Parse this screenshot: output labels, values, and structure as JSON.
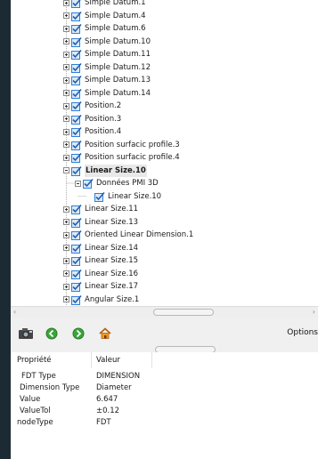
{
  "tree": {
    "rows": [
      {
        "label": "Simple Datum.1",
        "level": 0,
        "expander": "plus",
        "bold": false
      },
      {
        "label": "Simple Datum.4",
        "level": 0,
        "expander": "plus",
        "bold": false
      },
      {
        "label": "Simple Datum.6",
        "level": 0,
        "expander": "plus",
        "bold": false
      },
      {
        "label": "Simple Datum.10",
        "level": 0,
        "expander": "plus",
        "bold": false
      },
      {
        "label": "Simple Datum.11",
        "level": 0,
        "expander": "plus",
        "bold": false
      },
      {
        "label": "Simple Datum.12",
        "level": 0,
        "expander": "plus",
        "bold": false
      },
      {
        "label": "Simple Datum.13",
        "level": 0,
        "expander": "plus",
        "bold": false
      },
      {
        "label": "Simple Datum.14",
        "level": 0,
        "expander": "plus",
        "bold": false
      },
      {
        "label": "Position.2",
        "level": 0,
        "expander": "plus",
        "bold": false
      },
      {
        "label": "Position.3",
        "level": 0,
        "expander": "plus",
        "bold": false
      },
      {
        "label": "Position.4",
        "level": 0,
        "expander": "plus",
        "bold": false
      },
      {
        "label": "Position surfacic profile.3",
        "level": 0,
        "expander": "plus",
        "bold": false
      },
      {
        "label": "Position surfacic profile.4",
        "level": 0,
        "expander": "plus",
        "bold": false
      },
      {
        "label": "Linear Size.10",
        "level": 0,
        "expander": "minus",
        "bold": true
      },
      {
        "label": "Données PMI 3D",
        "level": 1,
        "expander": "minus",
        "bold": false
      },
      {
        "label": "Linear Size.10",
        "level": 2,
        "expander": "none",
        "bold": false
      },
      {
        "label": "Linear Size.11",
        "level": 0,
        "expander": "plus",
        "bold": false
      },
      {
        "label": "Linear Size.13",
        "level": 0,
        "expander": "plus",
        "bold": false
      },
      {
        "label": "Oriented Linear Dimension.1",
        "level": 0,
        "expander": "plus",
        "bold": false
      },
      {
        "label": "Linear Size.14",
        "level": 0,
        "expander": "plus",
        "bold": false
      },
      {
        "label": "Linear Size.15",
        "level": 0,
        "expander": "plus",
        "bold": false
      },
      {
        "label": "Linear Size.16",
        "level": 0,
        "expander": "plus",
        "bold": false
      },
      {
        "label": "Linear Size.17",
        "level": 0,
        "expander": "plus",
        "bold": false
      },
      {
        "label": "Angular Size.1",
        "level": 0,
        "expander": "plus",
        "bold": false
      }
    ]
  },
  "scroll": {
    "left_arrow": "‹",
    "right_arrow": "›"
  },
  "toolbar": {
    "icons": [
      "camera-icon",
      "back-arrow-icon",
      "forward-arrow-icon",
      "home-icon"
    ],
    "options_label": "Options"
  },
  "properties": {
    "headers": {
      "property": "Propriété",
      "value": "Valeur"
    },
    "rows": [
      {
        "name": "FDT Type",
        "value": "DIMENSION"
      },
      {
        "name": "Dimension Type",
        "value": "Diameter"
      },
      {
        "name": "Value",
        "value": "6.647"
      },
      {
        "name": "ValueTol",
        "value": "±0.12"
      },
      {
        "name": "nodeType",
        "value": "FDT"
      }
    ]
  },
  "colors": {
    "background_dark": "#1c2b33",
    "panel": "#f0f0f0",
    "checkbox_blue": "#2f7fd8",
    "nav_green": "#3aa53a",
    "home_orange": "#e8a020"
  }
}
